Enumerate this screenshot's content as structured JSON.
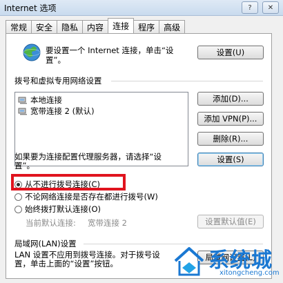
{
  "window": {
    "title": "Internet 选项"
  },
  "tabs": [
    "常规",
    "安全",
    "隐私",
    "内容",
    "连接",
    "程序",
    "高级"
  ],
  "active_tab": "连接",
  "setup": {
    "text": "要设置一个 Internet 连接，单击“设\n置”。",
    "button": "设置(U)"
  },
  "dialup": {
    "title": "拨号和虚拟专用网络设置",
    "connections": [
      "本地连接",
      "宽带连接 2 (默认)"
    ],
    "add_button": "添加(D)...",
    "add_vpn_button": "添加 VPN(P)...",
    "delete_button": "删除(R)...",
    "proxy_text": "如果要为连接配置代理服务器，请选择“设\n置”。",
    "settings_button": "设置(S)",
    "options": [
      {
        "label": "从不进行拨号连接(C)",
        "checked": true
      },
      {
        "label": "不论网络连接是否存在都进行拨号(W)",
        "checked": false
      },
      {
        "label": "始终拨打默认连接(O)",
        "checked": false
      }
    ],
    "current_default_label": "当前默认连接:",
    "current_default_value": "宽带连接 2",
    "set_default_button": "设置默认值(E)"
  },
  "lan": {
    "title": "局域网(LAN)设置",
    "text": "LAN 设置不应用到拨号连接。对于拨号设\n置，单击上面的“设置”按钮。",
    "button": "局域网设置(L)"
  },
  "watermark": {
    "text": "系统城",
    "url": "xitongcheng.com"
  },
  "colors": {
    "highlight": "#e0141e",
    "watermark": "#1a78d2"
  }
}
